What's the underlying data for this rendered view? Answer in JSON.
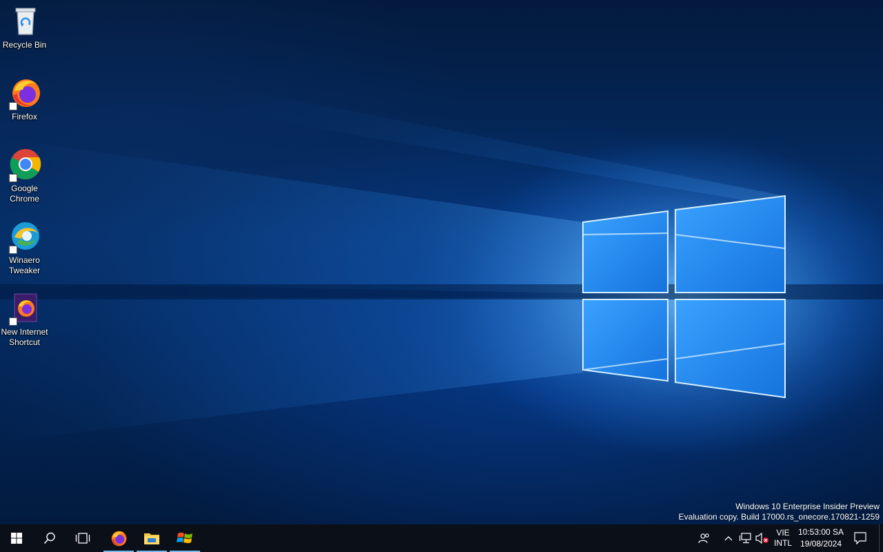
{
  "desktop": {
    "icons": [
      {
        "name": "recycle-bin",
        "label": "Recycle Bin",
        "icon": "recycle-bin-icon"
      },
      {
        "name": "firefox",
        "label": "Firefox",
        "icon": "firefox-icon"
      },
      {
        "name": "google-chrome",
        "label": "Google Chrome",
        "icon": "chrome-icon"
      },
      {
        "name": "winaero-tweaker",
        "label": "Winaero Tweaker",
        "icon": "winaero-tweaker-icon"
      },
      {
        "name": "new-internet-shortcut",
        "label": "New Internet Shortcut",
        "icon": "firefox-document-icon"
      }
    ],
    "watermark": {
      "line1": "Windows 10 Enterprise Insider Preview",
      "line2": "Evaluation copy. Build 17000.rs_onecore.170821-1259"
    }
  },
  "taskbar": {
    "start_icon": "windows-logo-icon",
    "search_icon": "search-icon",
    "task_view_icon": "task-view-icon",
    "pinned_apps": [
      {
        "name": "firefox",
        "icon": "firefox-icon",
        "running": true
      },
      {
        "name": "file-explorer",
        "icon": "folder-icon",
        "running": true
      },
      {
        "name": "winaero-tweaker",
        "icon": "windows-flag-icon",
        "running": true
      }
    ],
    "tray": {
      "people_icon": "people-icon",
      "chevron_icon": "chevron-up-icon",
      "network_icon": "network-icon",
      "volume_icon": "volume-muted-icon",
      "language": {
        "line1": "VIE",
        "line2": "INTL"
      },
      "clock": {
        "time": "10:53:00 SA",
        "date": "19/08/2024"
      },
      "notification_icon": "action-center-icon"
    },
    "accent_color": "#76b9ed",
    "background_color": "#0b0f18"
  }
}
